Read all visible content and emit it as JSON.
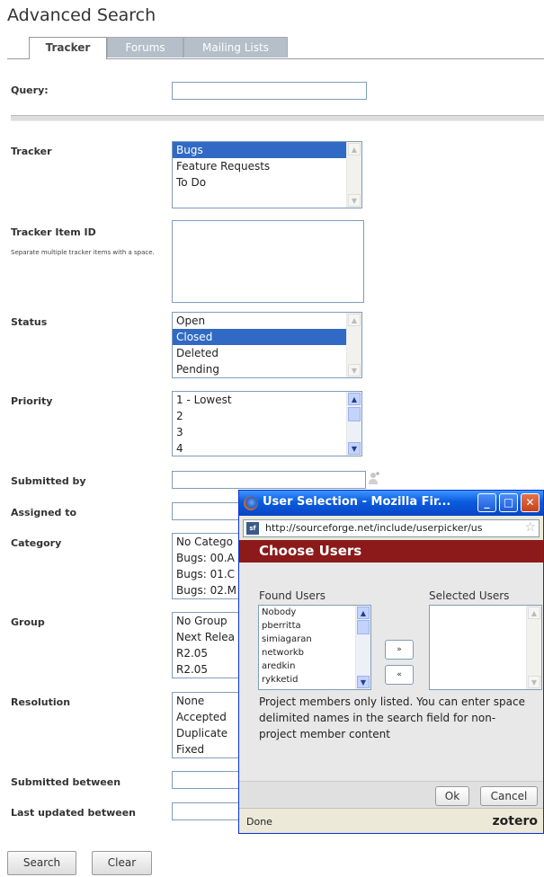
{
  "page_title": "Advanced Search",
  "tabs": [
    "Tracker",
    "Forums",
    "Mailing Lists"
  ],
  "fields": {
    "query": {
      "label": "Query:",
      "value": ""
    },
    "tracker": {
      "label": "Tracker",
      "options": [
        "Bugs",
        "Feature Requests",
        "To Do"
      ],
      "selected": "Bugs"
    },
    "tracker_item_id": {
      "label": "Tracker Item ID",
      "hint": "Separate multiple tracker items with a space."
    },
    "status": {
      "label": "Status",
      "options": [
        "Open",
        "Closed",
        "Deleted",
        "Pending"
      ],
      "selected": "Closed"
    },
    "priority": {
      "label": "Priority",
      "options": [
        "1 - Lowest",
        "2",
        "3",
        "4"
      ]
    },
    "submitted_by": {
      "label": "Submitted by",
      "value": ""
    },
    "assigned_to": {
      "label": "Assigned to",
      "value": ""
    },
    "category": {
      "label": "Category",
      "options": [
        "No Catego",
        "Bugs: 00.A",
        "Bugs: 01.C",
        "Bugs: 02.M"
      ]
    },
    "group": {
      "label": "Group",
      "options": [
        "No Group",
        "Next Relea",
        "R2.05",
        "R2.05"
      ]
    },
    "resolution": {
      "label": "Resolution",
      "options": [
        "None",
        "Accepted",
        "Duplicate",
        "Fixed"
      ]
    },
    "submitted_between": {
      "label": "Submitted between"
    },
    "last_updated_between": {
      "label": "Last updated between"
    }
  },
  "buttons": {
    "search": "Search",
    "clear": "Clear"
  },
  "popup": {
    "window_title": "User Selection - Mozilla Fir...",
    "url": "http://sourceforge.net/include/userpicker/us",
    "site_badge": "sf",
    "header": "Choose Users",
    "found_users_label": "Found Users",
    "selected_users_label": "Selected Users",
    "found_users": [
      "Nobody",
      "pberritta",
      "simiagaran",
      "networkb",
      "aredkin",
      "rykketid"
    ],
    "add_button": "»",
    "remove_button": "«",
    "info": "Project members only listed. You can enter space delimited names in the search field for non-project member content",
    "ok": "Ok",
    "cancel": "Cancel",
    "status": "Done",
    "addon": "zotero"
  }
}
